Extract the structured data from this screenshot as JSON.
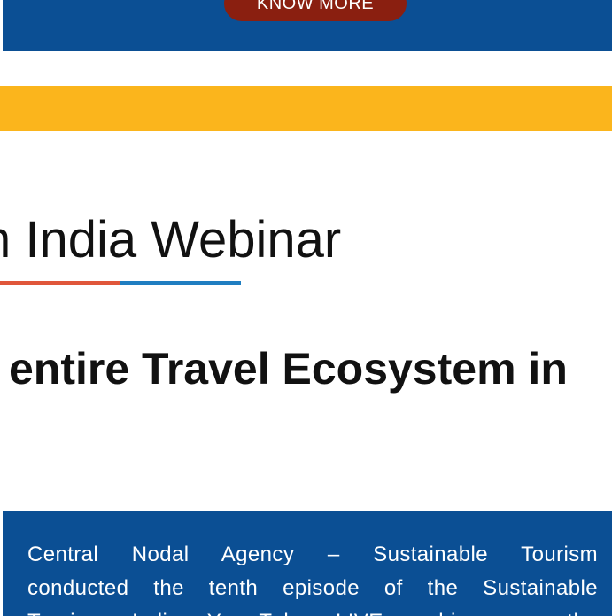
{
  "top_banner": {
    "button_label": "KNOW MORE"
  },
  "title": {
    "text": "n India Webinar"
  },
  "subtitle": {
    "text": "entire Travel Ecosystem in"
  },
  "content": {
    "lines": [
      "Central Nodal Agency – Sustainable Tourism",
      "conducted the tenth episode of the Sustainable",
      "Tourism India Yo Tube LIVE webinar on the"
    ]
  },
  "colors": {
    "banner_blue": "#0b4f94",
    "button_maroon": "#8a1f10",
    "band_yellow": "#fbb51c",
    "divider_red": "#e0563a",
    "divider_blue": "#1f7ec1"
  }
}
